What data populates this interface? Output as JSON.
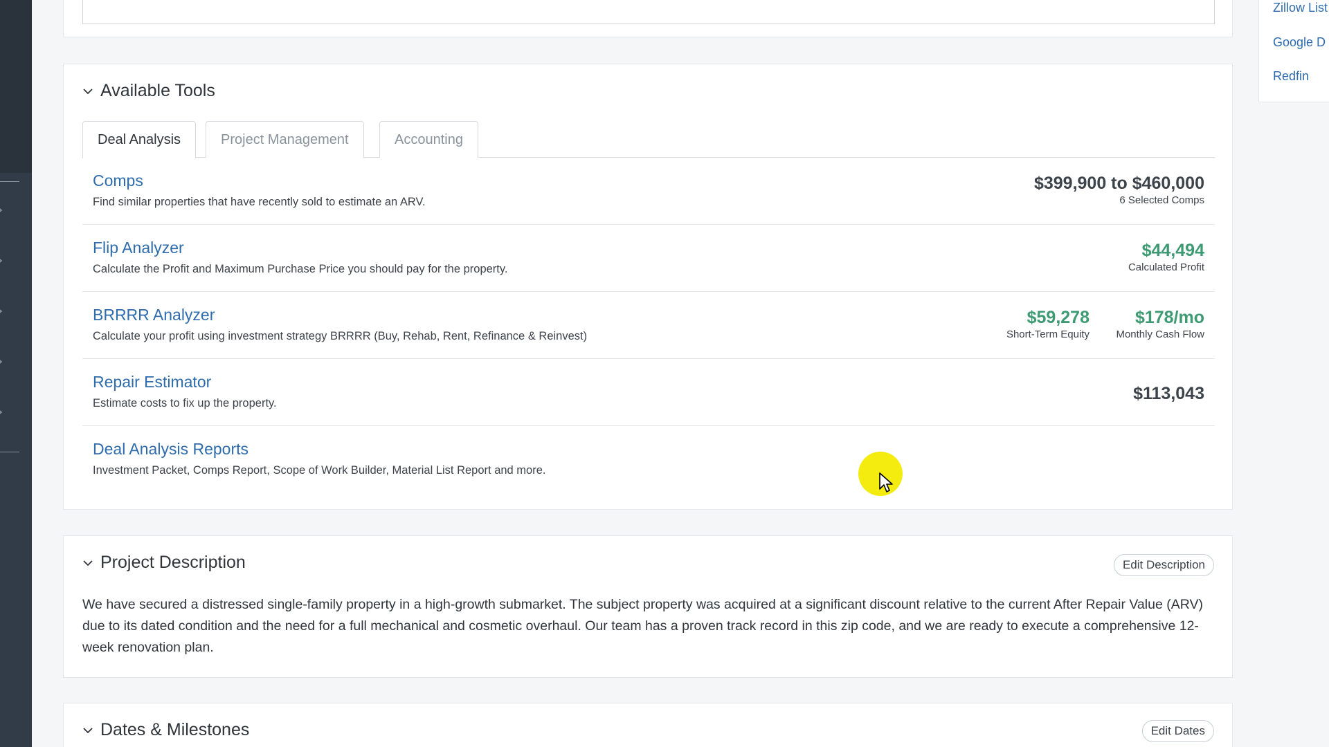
{
  "right_links": [
    "Zillow List",
    "Google D",
    "Redfin"
  ],
  "tools_section": {
    "title": "Available Tools",
    "tabs": [
      "Deal Analysis",
      "Project Management",
      "Accounting"
    ],
    "rows": [
      {
        "title": "Comps",
        "desc": "Find similar properties that have recently sold to estimate an ARV.",
        "metrics": [
          {
            "value": "$399,900 to $460,000",
            "label": "6 Selected Comps",
            "color": "#3d434a"
          }
        ]
      },
      {
        "title": "Flip Analyzer",
        "desc": "Calculate the Profit and Maximum Purchase Price you should pay for the property.",
        "metrics": [
          {
            "value": "$44,494",
            "label": "Calculated Profit",
            "color": "#3d9a73"
          }
        ]
      },
      {
        "title": "BRRRR Analyzer",
        "desc": "Calculate your profit using investment strategy BRRRR (Buy, Rehab, Rent, Refinance & Reinvest)",
        "metrics": [
          {
            "value": "$59,278",
            "label": "Short-Term Equity",
            "color": "#3d9a73"
          },
          {
            "value": "$178/mo",
            "label": "Monthly Cash Flow",
            "color": "#3d9a73"
          }
        ]
      },
      {
        "title": "Repair Estimator",
        "desc": "Estimate costs to fix up the property.",
        "metrics": [
          {
            "value": "$113,043",
            "label": "",
            "color": "#3d434a"
          }
        ]
      },
      {
        "title": "Deal Analysis Reports",
        "desc": "Investment Packet, Comps Report, Scope of Work Builder, Material List Report and more.",
        "metrics": []
      }
    ]
  },
  "description_section": {
    "title": "Project Description",
    "edit_label": "Edit Description",
    "text": "We have secured a distressed single-family property in a high-growth submarket. The subject property was acquired at a significant discount relative to the current After Repair Value (ARV) due to its dated condition and the need for a full mechanical and cosmetic overhaul. Our team has a proven track record in this zip code, and we are ready to execute a comprehensive 12-week renovation plan."
  },
  "dates_section": {
    "title": "Dates & Milestones",
    "edit_label": "Edit Dates"
  }
}
